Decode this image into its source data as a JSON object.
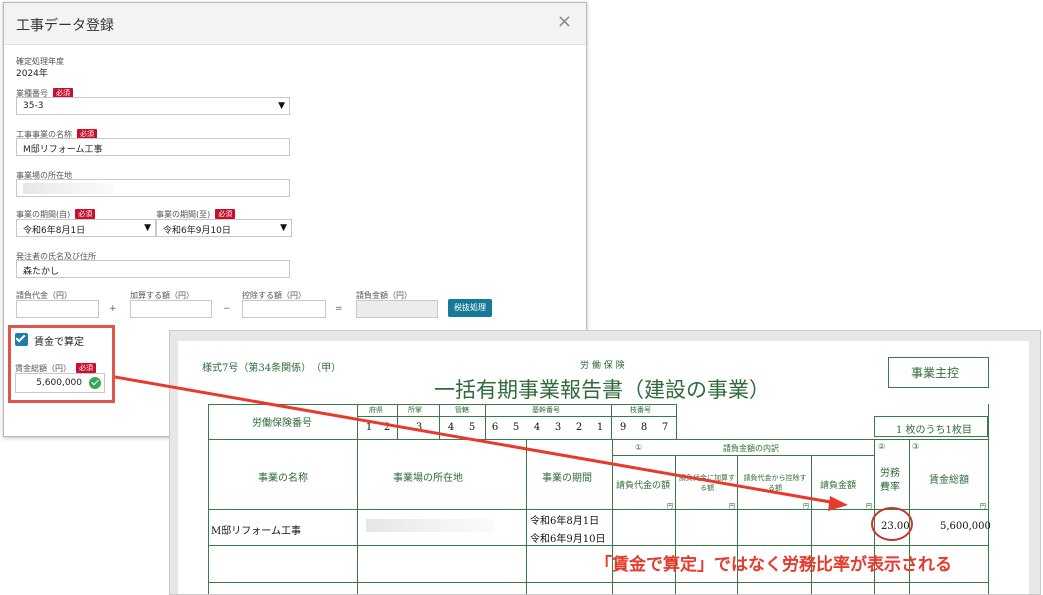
{
  "modal": {
    "title": "工事データ登録",
    "close_glyph": "×",
    "fiscal_year_label": "確定処理年度",
    "fiscal_year_value": "2024年",
    "required_badge": "必須",
    "industry_no_label": "業種番号",
    "industry_no_value": "35-3",
    "work_name_label": "工事事業の名称",
    "work_name_value": "M邸リフォーム工事",
    "site_address_label": "事業場の所在地",
    "period_from_label": "事業の期間(自)",
    "period_from_value": "令和6年8月1日",
    "period_to_label": "事業の期間(至)",
    "period_to_value": "令和6年9月10日",
    "orderer_label": "発注者の氏名及び住所",
    "orderer_value": "森たかし",
    "contract_amount_label": "請負代金（円）",
    "add_amount_label": "加算する額（円）",
    "deduct_amount_label": "控除する額（円）",
    "contract_total_label": "請負金額（円）",
    "op_plus": "+",
    "op_minus": "−",
    "op_equal": "=",
    "tax_button": "税抜処理",
    "wage_calc_checkbox": "賃金で算定",
    "wage_total_label": "賃金総額（円）",
    "wage_total_value": "5,600,000"
  },
  "report": {
    "form_id": "様式7号（第34条関係）　（甲）",
    "insurance_kind": "労 働 保 険",
    "title": "一括有期事業報告書（建設の事業）",
    "employer_box": "事業主控",
    "insurance_no_label": "労働保険番号",
    "pref_label": "府県",
    "office_label": "所掌",
    "jurisdiction_label": "管轄",
    "base_no_label": "基幹番号",
    "branch_no_label": "枝番号",
    "insurance_digits": [
      "1",
      "2",
      "3",
      "4",
      "5",
      "6",
      "5",
      "4",
      "3",
      "2",
      "1",
      "9",
      "8",
      "7"
    ],
    "page_info": "1 枚のうち1枚目",
    "col_name": "事業の名称",
    "col_address": "事業場の所在地",
    "col_period": "事業の期間",
    "circle1": "①",
    "contract_breakdown": "請負金額の内訳",
    "sub_contract_price": "請負代金の額",
    "sub_add": "請負代金に加算する額",
    "sub_deduct": "請負代金から控除する額",
    "sub_contract_amount": "請負金額",
    "circle2": "②",
    "circle3": "③",
    "col_labor_rate": "労務費率",
    "col_wage_total": "賃金総額",
    "yen": "円",
    "row_name": "M邸リフォーム工事",
    "row_period_from": "令和6年8月1日",
    "row_period_to": "令和6年9月10日",
    "row_labor_rate": "23.00",
    "row_wage_total": "5,600,000"
  },
  "annotation": {
    "note": "「賃金で算定」ではなく労務比率が表示される",
    "accent_color": "#e8392d"
  }
}
